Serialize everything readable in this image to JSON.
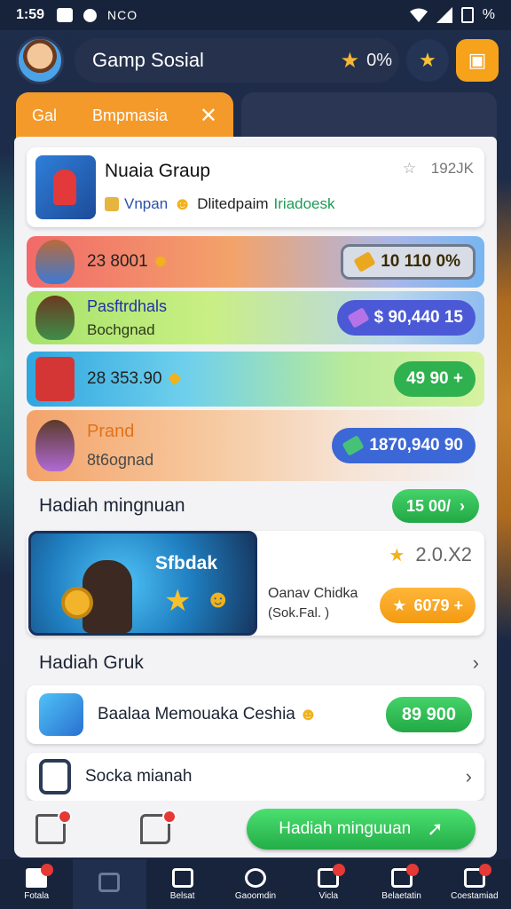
{
  "status_bar": {
    "time": "1:59",
    "carrier": "NCO",
    "battery": "%"
  },
  "header": {
    "app_title": "Gamp Sosial",
    "percent": "0%"
  },
  "tabs": {
    "tab1": "Gal",
    "tab2": "Bmpmasia"
  },
  "group": {
    "name": "Nuaia Graup",
    "rating": "192JK",
    "sub1": "Vnpan",
    "sub2": "Dlitedpaim",
    "sub3": "Iriadoesk"
  },
  "rewards": [
    {
      "text": "23 8001",
      "button": "10 110 0%"
    },
    {
      "line1": "Pasftrdhals",
      "line2": "Bochgnad",
      "button": "$ 90,440 15"
    },
    {
      "text": "28 353.90",
      "button": "49 90 +"
    },
    {
      "line1": "Prand",
      "line2": "8t6ognad",
      "button": "1870,940 90"
    }
  ],
  "weekly": {
    "title": "Hadiah mingnuan",
    "button": "15 00/",
    "banner_title": "Sfbdak",
    "rating": "2.0.X2",
    "line1": "Oanav Chidka",
    "line2": "(Sok.Fal.    )",
    "action": "6079 +"
  },
  "group_rewards": {
    "title": "Hadiah Gruk",
    "item1_label": "Baalaa Memouaka Ceshia",
    "item1_button": "89 900",
    "item2_label": "Socka mianah"
  },
  "action_bar": {
    "primary_button": "Hadiah minguuan"
  },
  "bottom_nav": {
    "items": [
      "Fotala",
      "",
      "Belsat",
      "Gaoomdin",
      "Vicla",
      "Belaetatin",
      "Coestamiad"
    ]
  },
  "colors": {
    "accent_orange": "#f39a2b",
    "accent_green": "#23ad48",
    "nav_bg": "#18243c"
  }
}
